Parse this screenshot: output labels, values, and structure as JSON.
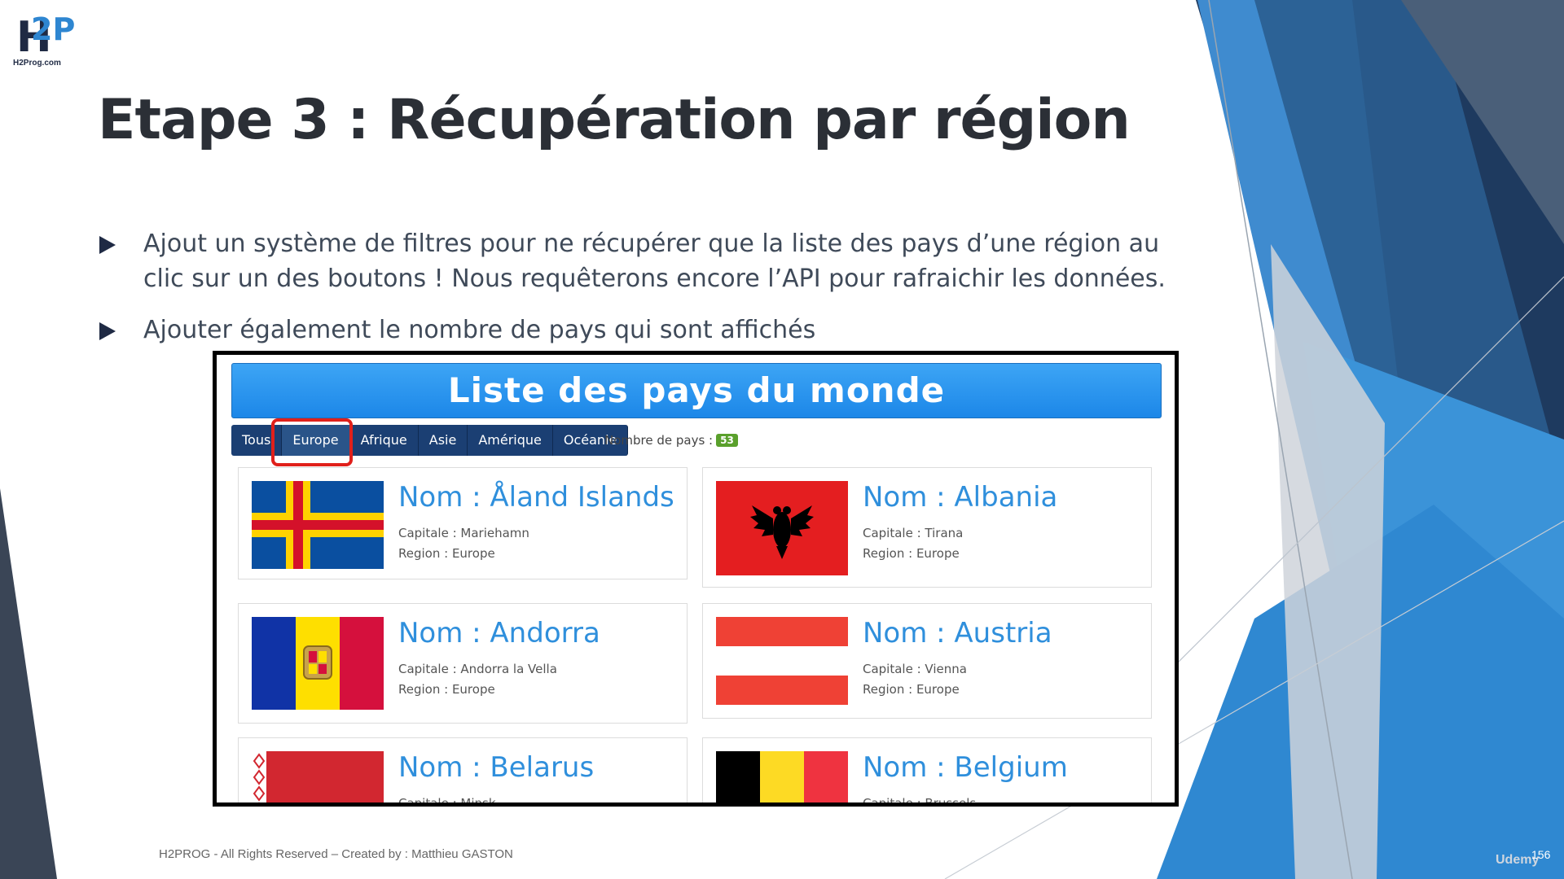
{
  "logo": {
    "mark": "H",
    "mark_accent": "2P",
    "site": "H2Prog.com"
  },
  "slide": {
    "title": "Etape 3 : Récupération par région",
    "bullets": [
      "Ajout un système de filtres pour ne récupérer que la liste des pays d’une région au clic sur un des boutons ! Nous requêterons encore l’API pour rafraichir les données.",
      "Ajouter également le nombre de pays qui sont affichés"
    ],
    "footer": "H2PROG - All Rights Reserved – Created by : Matthieu GASTON",
    "page_number": "156",
    "watermark": "Udemy"
  },
  "app": {
    "banner_title": "Liste des pays du monde",
    "filters": [
      "Tous",
      "Europe",
      "Afrique",
      "Asie",
      "Amérique",
      "Océanie"
    ],
    "active_filter": "Europe",
    "count_label": "Nombre de pays :",
    "count_value": "53",
    "countries": [
      {
        "name": "Nom : Åland Islands",
        "capital": "Capitale : Mariehamn",
        "region": "Region : Europe",
        "flag_icon": "aland-flag-icon"
      },
      {
        "name": "Nom : Albania",
        "capital": "Capitale : Tirana",
        "region": "Region : Europe",
        "flag_icon": "albania-flag-icon"
      },
      {
        "name": "Nom : Andorra",
        "capital": "Capitale : Andorra la Vella",
        "region": "Region : Europe",
        "flag_icon": "andorra-flag-icon"
      },
      {
        "name": "Nom : Austria",
        "capital": "Capitale : Vienna",
        "region": "Region : Europe",
        "flag_icon": "austria-flag-icon"
      },
      {
        "name": "Nom : Belarus",
        "capital": "Capitale : Minsk",
        "flag_icon": "belarus-flag-icon"
      },
      {
        "name": "Nom : Belgium",
        "capital": "Capitale : Brussels",
        "flag_icon": "belgium-flag-icon"
      }
    ]
  },
  "colors": {
    "accent_blue": "#2f8fdc",
    "dark_navy": "#1b3f73",
    "highlight_red": "#e0201b",
    "badge_green": "#5aa02c"
  }
}
